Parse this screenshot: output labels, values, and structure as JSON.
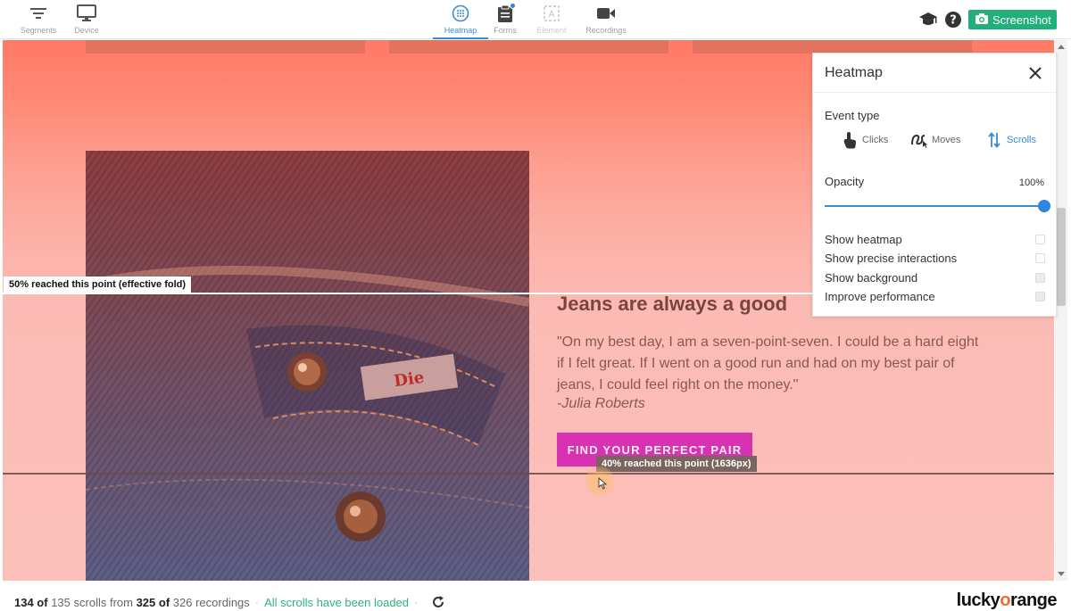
{
  "toolbar": {
    "left": [
      {
        "label": "Segments",
        "icon": "filter-icon"
      },
      {
        "label": "Device",
        "icon": "monitor-icon"
      }
    ],
    "center": [
      {
        "label": "Heatmap",
        "icon": "heatmap-icon",
        "active": true
      },
      {
        "label": "Forms",
        "icon": "clipboard-icon",
        "badge": true
      },
      {
        "label": "Element",
        "icon": "element-select-icon",
        "disabled": true
      },
      {
        "label": "Recordings",
        "icon": "video-camera-icon"
      }
    ],
    "right": {
      "help_icon": "graduation-cap-icon",
      "question_icon": "question-circle-icon",
      "screenshot_label": "Screenshot"
    }
  },
  "page": {
    "headline": "Jeans are always a good",
    "quote": "\"On my best day, I am a seven-point-seven. I could be a hard eight if I felt great. If I went on a good run and had on my best pair of jeans, I could feel right on the money.\"",
    "author": "-Julia Roberts",
    "cta_label": "FIND YOUR PERFECT PAIR"
  },
  "scroll_markers": [
    {
      "label": "50% reached this point (effective fold)",
      "percent": 50
    },
    {
      "label": "40% reached this point (1636px)",
      "percent": 40
    }
  ],
  "heatmap_panel": {
    "title": "Heatmap",
    "event_type_label": "Event type",
    "event_types": [
      {
        "label": "Clicks",
        "icon": "hand-pointer-icon",
        "active": false
      },
      {
        "label": "Moves",
        "icon": "mouse-trail-icon",
        "active": false
      },
      {
        "label": "Scrolls",
        "icon": "scroll-arrows-icon",
        "active": true
      }
    ],
    "opacity_label": "Opacity",
    "opacity_value": "100%",
    "opacity_level": 1.0,
    "options": [
      {
        "label": "Show heatmap",
        "checked": false
      },
      {
        "label": "Show precise interactions",
        "checked": false
      },
      {
        "label": "Show background",
        "checked": true
      },
      {
        "label": "Improve performance",
        "checked": true
      }
    ]
  },
  "footer": {
    "scrolls_shown": "134 of",
    "scrolls_text": "135 scrolls from",
    "recordings_shown": "325 of",
    "recordings_text": "326 recordings",
    "separator": "·",
    "status": "All scrolls have been loaded",
    "separator2": "·",
    "logo_prefix": "lucky",
    "logo_o": "o",
    "logo_suffix": "range"
  },
  "colors": {
    "accent": "#3b8bd1",
    "screenshot_button": "#22b07a",
    "cta": "#d632b1",
    "status_ok": "#2db37c",
    "logo_orange": "#f26b2c"
  }
}
